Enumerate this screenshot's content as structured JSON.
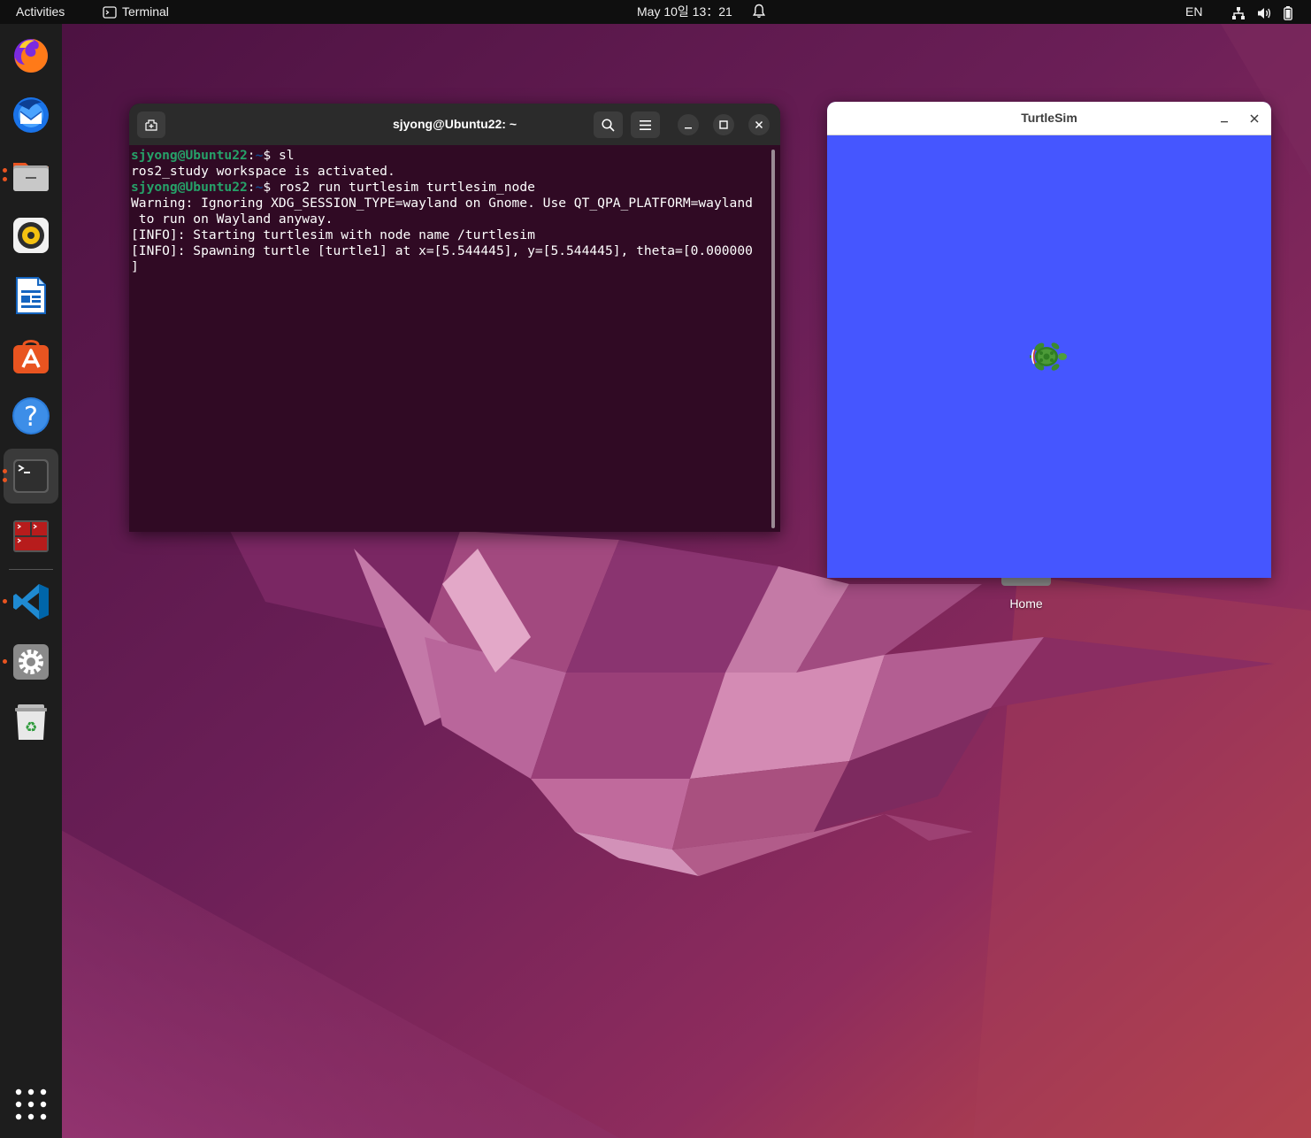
{
  "topbar": {
    "activities": "Activities",
    "app_name": "Terminal",
    "clock": "May 10일  13：21",
    "language": "EN"
  },
  "dock": {
    "items": [
      {
        "name": "firefox",
        "running": false
      },
      {
        "name": "thunderbird",
        "running": false
      },
      {
        "name": "files",
        "running": true
      },
      {
        "name": "rhythmbox",
        "running": false
      },
      {
        "name": "libreoffice-writer",
        "running": false
      },
      {
        "name": "ubuntu-software",
        "running": false
      },
      {
        "name": "help",
        "running": false
      },
      {
        "name": "terminal",
        "running": true,
        "active": true
      },
      {
        "name": "terminator",
        "running": false
      },
      {
        "name": "vscode",
        "running": true
      },
      {
        "name": "settings",
        "running": true
      },
      {
        "name": "trash",
        "running": false
      }
    ]
  },
  "terminal": {
    "title": "sjyong@Ubuntu22: ~",
    "prompt_user": "sjyong@Ubuntu22",
    "prompt_path": "~",
    "cmd1": "sl",
    "out1": "ros2_study workspace is activated.",
    "cmd2": "ros2 run turtlesim turtlesim_node",
    "out2": "Warning: Ignoring XDG_SESSION_TYPE=wayland on Gnome. Use QT_QPA_PLATFORM=wayland",
    "out3": " to run on Wayland anyway.",
    "out4": "[INFO]: Starting turtlesim with node name /turtlesim",
    "out5": "[INFO]: Spawning turtle [turtle1] at x=[5.544445], y=[5.544445], theta=[0.000000",
    "out6": "]"
  },
  "turtlesim": {
    "title": "TurtleSim",
    "background_color": "#4556ff"
  },
  "desktop": {
    "home_label": "Home"
  },
  "colors": {
    "accent": "#e95420",
    "terminal_bg": "#300a24",
    "prompt_user": "#26a269",
    "prompt_path": "#12488b"
  }
}
